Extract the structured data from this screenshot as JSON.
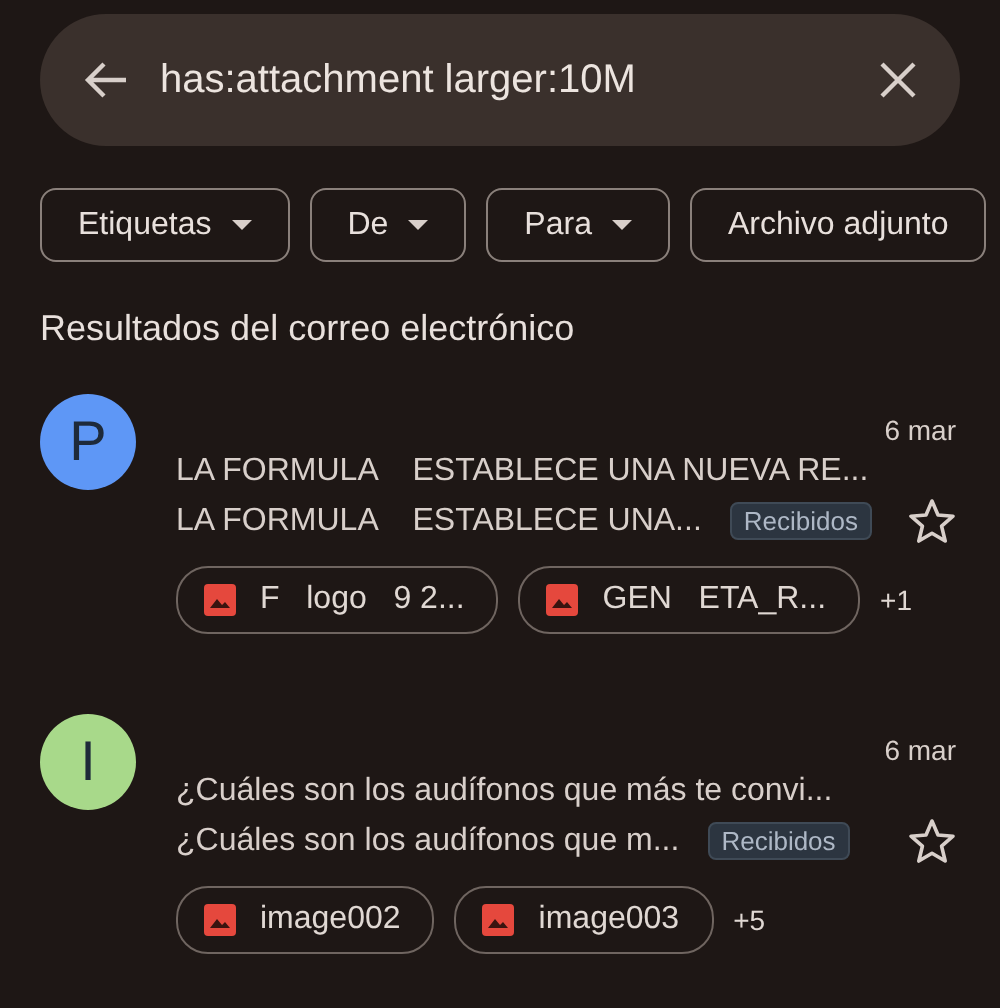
{
  "search": {
    "value": "has:attachment larger:10M"
  },
  "filters": [
    {
      "label": "Etiquetas",
      "dropdown": true
    },
    {
      "label": "De",
      "dropdown": true
    },
    {
      "label": "Para",
      "dropdown": true
    },
    {
      "label": "Archivo adjunto",
      "dropdown": false
    }
  ],
  "section_title": "Resultados del correo electrónico",
  "emails": [
    {
      "avatar": "P",
      "color": "#5e97f6",
      "date": "6 mar",
      "subject": "LA FORMULA    ESTABLECE UNA NUEVA RE...",
      "snippet": "LA FORMULA    ESTABLECE UNA...",
      "label": "Recibidos",
      "starred": false,
      "attachments": [
        "F   logo   9 2...",
        "GEN   ETA_R..."
      ],
      "more": "+1"
    },
    {
      "avatar": "I",
      "color": "#a8d98a",
      "date": "6 mar",
      "subject": "¿Cuáles son los audífonos que más te convi...",
      "snippet": "¿Cuáles son los audífonos que m...",
      "label": "Recibidos",
      "starred": false,
      "attachments": [
        "image002",
        "image003"
      ],
      "more": "+5"
    }
  ]
}
